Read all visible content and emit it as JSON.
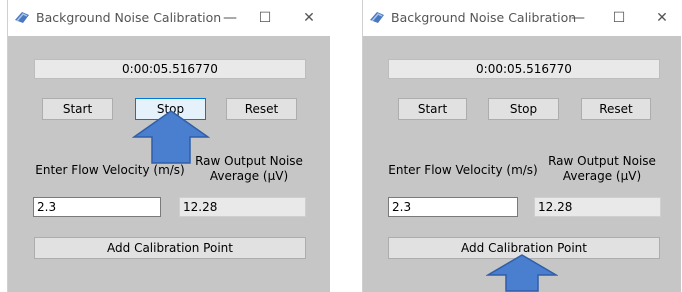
{
  "window_title": "Background Noise Calibration",
  "controls": {
    "minimize": "—",
    "maximize": "☐",
    "close": "✕"
  },
  "timer": "0:00:05.516770",
  "buttons": {
    "start": "Start",
    "stop": "Stop",
    "reset": "Reset",
    "add_point": "Add Calibration Point"
  },
  "labels": {
    "flow_velocity": "Enter Flow Velocity (m/s)",
    "raw_output_line1": "Raw Output Noise",
    "raw_output_line2": "Average (µV)"
  },
  "inputs": {
    "flow_velocity_value": "2.3",
    "raw_output_value": "12.28"
  },
  "colors": {
    "arrow": "#4a7fcf",
    "arrow_border": "#2f5fa8",
    "window_bg": "#c6c6c6"
  }
}
